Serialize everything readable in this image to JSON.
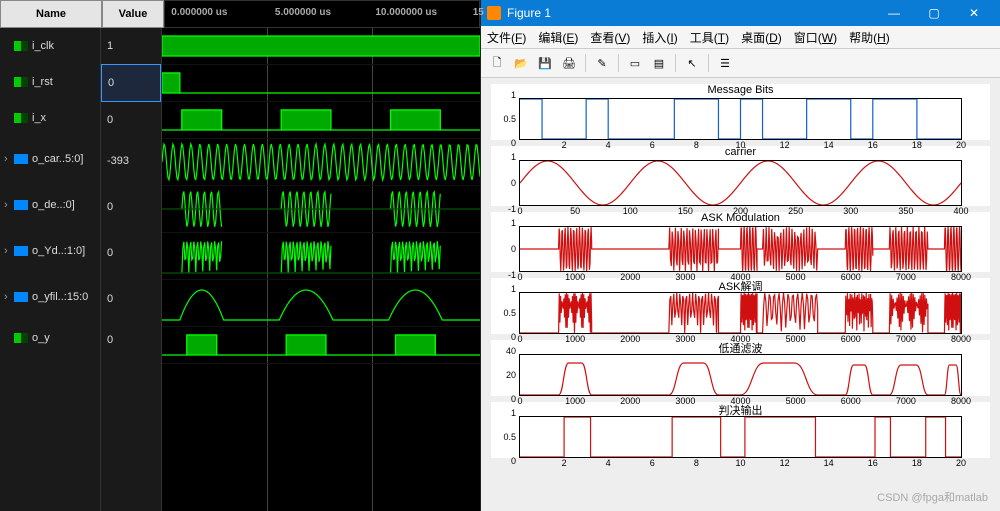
{
  "wave": {
    "headers": {
      "name": "Name",
      "value": "Value"
    },
    "timescale": [
      {
        "label": "0.000000 us",
        "pos": 2
      },
      {
        "label": "5.000000 us",
        "pos": 35
      },
      {
        "label": "10.000000 us",
        "pos": 67
      },
      {
        "label": "15",
        "pos": 98
      }
    ],
    "signals": [
      {
        "name": "i_clk",
        "value": "1",
        "type": "bit"
      },
      {
        "name": "i_rst",
        "value": "0",
        "type": "bit",
        "selected": true
      },
      {
        "name": "i_x",
        "value": "0",
        "type": "bit"
      },
      {
        "name": "o_car..5:0]",
        "value": "-393",
        "type": "bus"
      },
      {
        "name": "o_de..:0]",
        "value": "0",
        "type": "bus"
      },
      {
        "name": "o_Yd..:1:0]",
        "value": "0",
        "type": "bus"
      },
      {
        "name": "o_yfil..:15:0",
        "value": "0",
        "type": "bus"
      },
      {
        "name": "o_y",
        "value": "0",
        "type": "bit"
      }
    ]
  },
  "matlab": {
    "title": "Figure 1",
    "menus": [
      "文件(F)",
      "编辑(E)",
      "查看(V)",
      "插入(I)",
      "工具(T)",
      "桌面(D)",
      "窗口(W)",
      "帮助(H)"
    ],
    "toolbar_icons": [
      "new",
      "open",
      "save",
      "print",
      "|",
      "edit",
      "|",
      "databrush",
      "colorbar",
      "|",
      "cursor",
      "|",
      "legend"
    ]
  },
  "chart_data": [
    {
      "type": "line",
      "title": "Message Bits",
      "color": "#1060d0",
      "xlim": [
        0,
        20
      ],
      "ylim": [
        0,
        1
      ],
      "yticks": [
        0,
        0.5,
        1
      ],
      "xticks": [
        2,
        4,
        6,
        8,
        10,
        12,
        14,
        16,
        18,
        20
      ],
      "x": [
        0,
        1,
        1,
        3,
        3,
        4,
        4,
        7,
        7,
        9,
        9,
        10,
        10,
        11,
        11,
        13,
        13,
        15,
        15,
        16,
        16,
        18,
        18,
        20
      ],
      "y": [
        1,
        1,
        0,
        0,
        1,
        1,
        0,
        0,
        1,
        1,
        0,
        0,
        1,
        1,
        0,
        0,
        1,
        1,
        0,
        0,
        1,
        1,
        0,
        0
      ]
    },
    {
      "type": "line",
      "title": "carrier",
      "color": "#d01010",
      "xlim": [
        0,
        400
      ],
      "ylim": [
        -1,
        1
      ],
      "yticks": [
        -1,
        0,
        1
      ],
      "xticks": [
        0,
        50,
        100,
        150,
        200,
        250,
        300,
        350,
        400
      ],
      "cycles": 4,
      "amp": 1
    },
    {
      "type": "line",
      "title": "ASK Modulation",
      "color": "#d01010",
      "xlim": [
        0,
        8000
      ],
      "ylim": [
        -1,
        1
      ],
      "yticks": [
        -1,
        0,
        1
      ],
      "xticks": [
        0,
        1000,
        2000,
        3000,
        4000,
        5000,
        6000,
        7000,
        8000
      ],
      "bursts": [
        [
          700,
          1300
        ],
        [
          2700,
          3600
        ],
        [
          4000,
          4300
        ],
        [
          4400,
          5400
        ],
        [
          5900,
          6400
        ],
        [
          6700,
          7400
        ],
        [
          7700,
          8000
        ]
      ]
    },
    {
      "type": "line",
      "title": "ASK解调",
      "color": "#d01010",
      "xlim": [
        0,
        8000
      ],
      "ylim": [
        0,
        1
      ],
      "yticks": [
        0,
        0.5,
        1
      ],
      "xticks": [
        0,
        1000,
        2000,
        3000,
        4000,
        5000,
        6000,
        7000,
        8000
      ],
      "bursts": [
        [
          700,
          1300
        ],
        [
          2700,
          3600
        ],
        [
          4000,
          4300
        ],
        [
          4400,
          5400
        ],
        [
          5900,
          6400
        ],
        [
          6700,
          7400
        ],
        [
          7700,
          8000
        ]
      ]
    },
    {
      "type": "line",
      "title": "低通滤波",
      "color": "#d01010",
      "xlim": [
        0,
        8000
      ],
      "ylim": [
        0,
        40
      ],
      "yticks": [
        0,
        20,
        40
      ],
      "xticks": [
        0,
        1000,
        2000,
        3000,
        4000,
        5000,
        6000,
        7000,
        8000
      ],
      "env": [
        [
          700,
          1300,
          32
        ],
        [
          2700,
          3600,
          32
        ],
        [
          4000,
          5400,
          32
        ],
        [
          5900,
          6400,
          30
        ],
        [
          6700,
          7400,
          30
        ],
        [
          7700,
          8000,
          30
        ]
      ]
    },
    {
      "type": "line",
      "title": "判决输出",
      "color": "#d01010",
      "xlim": [
        0,
        20
      ],
      "ylim": [
        0,
        1
      ],
      "yticks": [
        0,
        0.5,
        1
      ],
      "xticks": [
        2,
        4,
        6,
        8,
        10,
        12,
        14,
        16,
        18,
        20
      ],
      "x": [
        0,
        2,
        2,
        3.2,
        3.2,
        6.9,
        6.9,
        9.1,
        9.1,
        10.2,
        10.2,
        13.4,
        13.4,
        16.1,
        16.1,
        16.8,
        16.8,
        18.4,
        18.4,
        19.3,
        19.3,
        20
      ],
      "y": [
        0,
        0,
        1,
        1,
        0,
        0,
        1,
        1,
        0,
        0,
        1,
        1,
        0,
        0,
        1,
        1,
        0,
        0,
        1,
        1,
        0,
        0
      ]
    }
  ],
  "watermark": "CSDN @fpga和matlab"
}
